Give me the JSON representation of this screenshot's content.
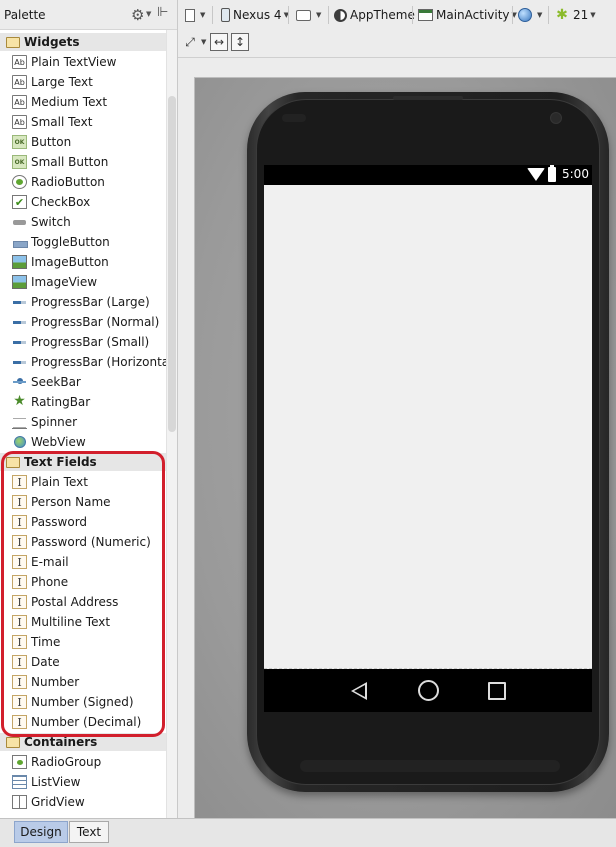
{
  "palette": {
    "title": "Palette",
    "categories": [
      {
        "label": "Widgets",
        "items": [
          {
            "label": "Plain TextView",
            "icon": "ab-text-icon"
          },
          {
            "label": "Large Text",
            "icon": "ab-text-icon"
          },
          {
            "label": "Medium Text",
            "icon": "ab-text-icon"
          },
          {
            "label": "Small Text",
            "icon": "ab-text-icon"
          },
          {
            "label": "Button",
            "icon": "ok-button-icon"
          },
          {
            "label": "Small Button",
            "icon": "ok-button-icon"
          },
          {
            "label": "RadioButton",
            "icon": "radio-icon"
          },
          {
            "label": "CheckBox",
            "icon": "checkbox-icon"
          },
          {
            "label": "Switch",
            "icon": "switch-icon"
          },
          {
            "label": "ToggleButton",
            "icon": "toggle-icon"
          },
          {
            "label": "ImageButton",
            "icon": "image-icon"
          },
          {
            "label": "ImageView",
            "icon": "image-icon"
          },
          {
            "label": "ProgressBar (Large)",
            "icon": "progress-icon"
          },
          {
            "label": "ProgressBar (Normal)",
            "icon": "progress-icon"
          },
          {
            "label": "ProgressBar (Small)",
            "icon": "progress-icon"
          },
          {
            "label": "ProgressBar (Horizontal)",
            "icon": "progress-icon"
          },
          {
            "label": "SeekBar",
            "icon": "seekbar-icon"
          },
          {
            "label": "RatingBar",
            "icon": "star-icon"
          },
          {
            "label": "Spinner",
            "icon": "spinner-icon"
          },
          {
            "label": "WebView",
            "icon": "globe-icon"
          }
        ]
      },
      {
        "label": "Text Fields",
        "items": [
          {
            "label": "Plain Text",
            "icon": "text-field-icon"
          },
          {
            "label": "Person Name",
            "icon": "text-field-icon"
          },
          {
            "label": "Password",
            "icon": "text-field-icon"
          },
          {
            "label": "Password (Numeric)",
            "icon": "text-field-icon"
          },
          {
            "label": "E-mail",
            "icon": "text-field-icon"
          },
          {
            "label": "Phone",
            "icon": "text-field-icon"
          },
          {
            "label": "Postal Address",
            "icon": "text-field-icon"
          },
          {
            "label": "Multiline Text",
            "icon": "text-field-icon"
          },
          {
            "label": "Time",
            "icon": "text-field-icon"
          },
          {
            "label": "Date",
            "icon": "text-field-icon"
          },
          {
            "label": "Number",
            "icon": "text-field-icon"
          },
          {
            "label": "Number (Signed)",
            "icon": "text-field-icon"
          },
          {
            "label": "Number (Decimal)",
            "icon": "text-field-icon"
          }
        ]
      },
      {
        "label": "Containers",
        "items": [
          {
            "label": "RadioGroup",
            "icon": "radio-group-icon"
          },
          {
            "label": "ListView",
            "icon": "list-icon"
          },
          {
            "label": "GridView",
            "icon": "grid-icon"
          }
        ]
      }
    ]
  },
  "toolbar": {
    "device": "Nexus 4",
    "theme": "AppTheme",
    "activity": "MainActivity",
    "api_level": "21"
  },
  "phone": {
    "time": "5:00"
  },
  "bottom_tabs": {
    "design": "Design",
    "text": "Text"
  },
  "colors": {
    "highlight": "#d21f2c",
    "active_tab": "#b9cbe8"
  }
}
